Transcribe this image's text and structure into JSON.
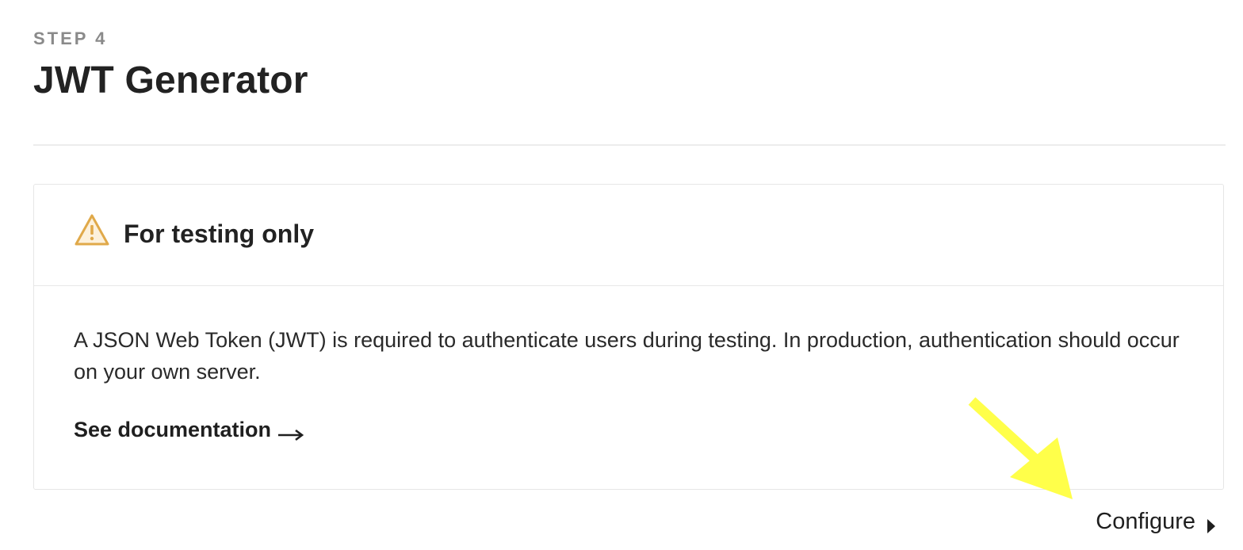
{
  "header": {
    "step_label": "STEP 4",
    "title": "JWT Generator"
  },
  "card": {
    "icon": "warning-triangle-icon",
    "title": "For testing only",
    "body": "A JSON Web Token (JWT) is required to authenticate users during testing. In production, authentication should occur on your own server.",
    "link_label": "See documentation"
  },
  "footer": {
    "configure_label": "Configure"
  },
  "colors": {
    "warning": "#e0a94a",
    "annotation": "#ffff4a"
  }
}
